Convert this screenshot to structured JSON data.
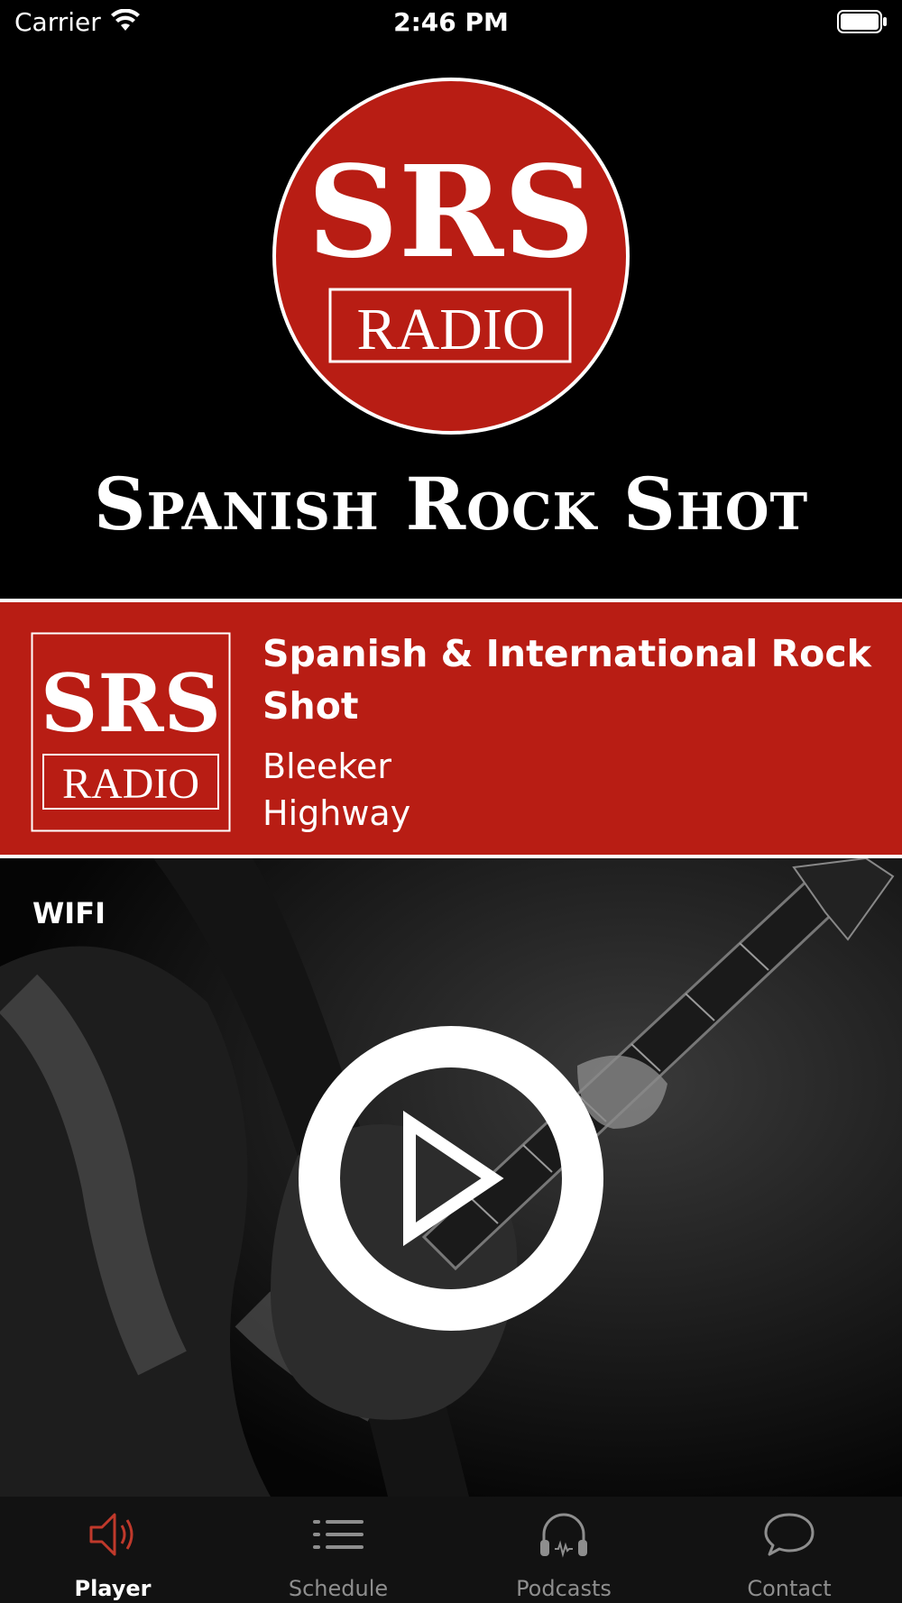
{
  "status_bar": {
    "carrier": "Carrier",
    "time": "2:46 PM"
  },
  "header": {
    "logo_text_top": "SRS",
    "logo_text_bottom": "RADIO",
    "station_name": "Spanish Rock Shot"
  },
  "now_playing": {
    "logo_text_top": "SRS",
    "logo_text_bottom": "RADIO",
    "program_title": "Spanish & International Rock Shot",
    "artist": "Bleeker",
    "song": "Highway"
  },
  "player": {
    "connection_type": "WIFI"
  },
  "tab_bar": {
    "tabs": [
      {
        "label": "Player",
        "icon": "speaker-icon",
        "active": true
      },
      {
        "label": "Schedule",
        "icon": "list-icon",
        "active": false
      },
      {
        "label": "Podcasts",
        "icon": "headphones-icon",
        "active": false
      },
      {
        "label": "Contact",
        "icon": "chat-bubble-icon",
        "active": false
      }
    ]
  },
  "colors": {
    "brand_red": "#b81d14",
    "background": "#000000",
    "tab_active": "#c0392b",
    "tab_inactive": "#8e8e8e"
  }
}
